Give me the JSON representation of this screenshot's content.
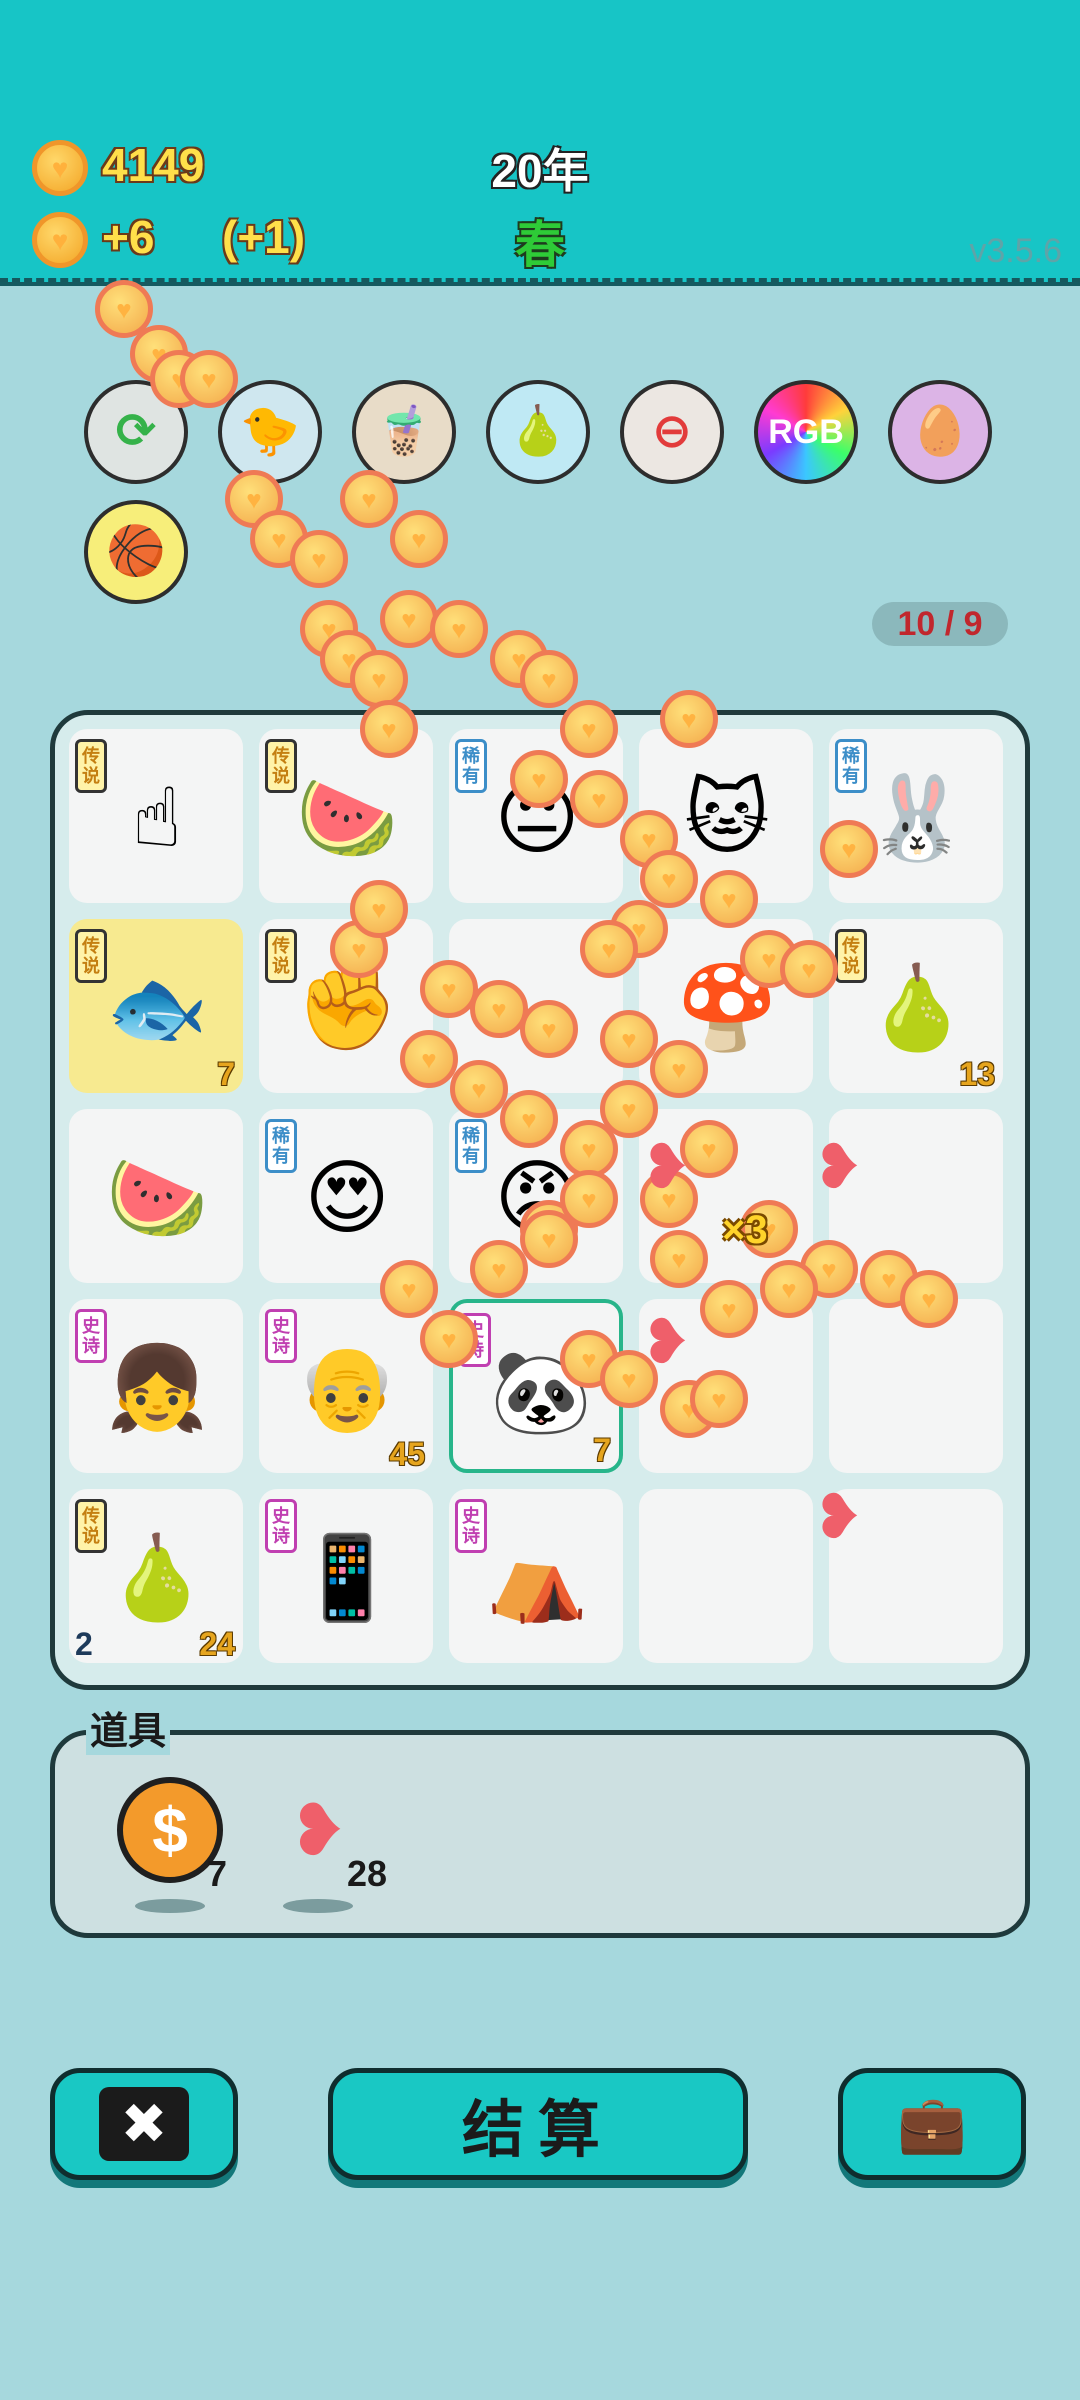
{
  "header": {
    "coins": "4149",
    "income": "+6",
    "bonus": "(+1)",
    "year": "20年",
    "season": "春",
    "version": "v3.5.6"
  },
  "toolbar": {
    "icons": [
      "refresh-heart-icon",
      "duck-pot-icon",
      "milk-tea-icon",
      "pomelo-icon",
      "minus-heart-icon",
      "rgb-icon",
      "egg-icon",
      "basketballs-icon"
    ],
    "rgb_label": "RGB"
  },
  "spin_counter": "10 / 9",
  "board": {
    "cells": [
      {
        "rarity": "传说",
        "item": "hand-pointer-icon",
        "glyph": "☝",
        "count": ""
      },
      {
        "rarity": "传说",
        "item": "melon-icon",
        "glyph": "🍉",
        "count": ""
      },
      {
        "rarity": "稀有",
        "item": "face-icon",
        "glyph": "😐",
        "count": ""
      },
      {
        "rarity": "",
        "item": "cat-icon",
        "glyph": "🐱",
        "count": ""
      },
      {
        "rarity": "稀有",
        "item": "rabbit-icon",
        "glyph": "🐰",
        "count": ""
      },
      {
        "rarity": "传说",
        "item": "koi-fish-icon",
        "glyph": "🐟",
        "count": "7",
        "gold": true
      },
      {
        "rarity": "传说",
        "item": "fist-icon",
        "glyph": "✊",
        "count": ""
      },
      {
        "rarity": "",
        "item": "coin-effect-icon",
        "glyph": "",
        "count": ""
      },
      {
        "rarity": "",
        "item": "mushroom-icon",
        "glyph": "🍄",
        "count": ""
      },
      {
        "rarity": "传说",
        "item": "golden-gourds-icon",
        "glyph": "🍐",
        "count": "13"
      },
      {
        "rarity": "",
        "item": "watermelon-slice-icon",
        "glyph": "🍉",
        "count": ""
      },
      {
        "rarity": "稀有",
        "item": "bald-heart-eyes-icon",
        "glyph": "😍",
        "count": ""
      },
      {
        "rarity": "稀有",
        "item": "grumpy-man-icon",
        "glyph": "😠",
        "count": ""
      },
      {
        "rarity": "",
        "item": "empty",
        "glyph": "",
        "count": ""
      },
      {
        "rarity": "",
        "item": "empty",
        "glyph": "",
        "count": ""
      },
      {
        "rarity": "史诗",
        "item": "girl-icon",
        "glyph": "👧",
        "count": ""
      },
      {
        "rarity": "史诗",
        "item": "old-man-icon",
        "glyph": "👴",
        "count": "45"
      },
      {
        "rarity": "史诗",
        "item": "panda-icon",
        "glyph": "🐼",
        "count": "7",
        "selected": true
      },
      {
        "rarity": "",
        "item": "empty",
        "glyph": "",
        "count": ""
      },
      {
        "rarity": "",
        "item": "empty",
        "glyph": "",
        "count": ""
      },
      {
        "rarity": "传说",
        "item": "pear-icon",
        "glyph": "🍐",
        "count": "24",
        "count_left": "2"
      },
      {
        "rarity": "史诗",
        "item": "phone-case-icon",
        "glyph": "📱",
        "count": ""
      },
      {
        "rarity": "史诗",
        "item": "rabbit-house-icon",
        "glyph": "⛺",
        "count": ""
      },
      {
        "rarity": "",
        "item": "empty",
        "glyph": "",
        "count": ""
      },
      {
        "rarity": "",
        "item": "empty",
        "glyph": "",
        "count": ""
      }
    ]
  },
  "props": {
    "title": "道具",
    "items": [
      {
        "name": "dollar-coin-icon",
        "glyph": "$",
        "count": "7"
      },
      {
        "name": "liver-icon",
        "glyph": "❥",
        "count": "28"
      }
    ]
  },
  "effect": {
    "multiplier": "×3"
  },
  "buttons": {
    "delete_glyph": "✖",
    "settle": "结算",
    "bag_glyph": "💼"
  },
  "colors": {
    "header_bg": "#17c5c6",
    "page_bg": "#a6d8dd",
    "coin": "#f3a526",
    "button": "#19c8c4"
  }
}
